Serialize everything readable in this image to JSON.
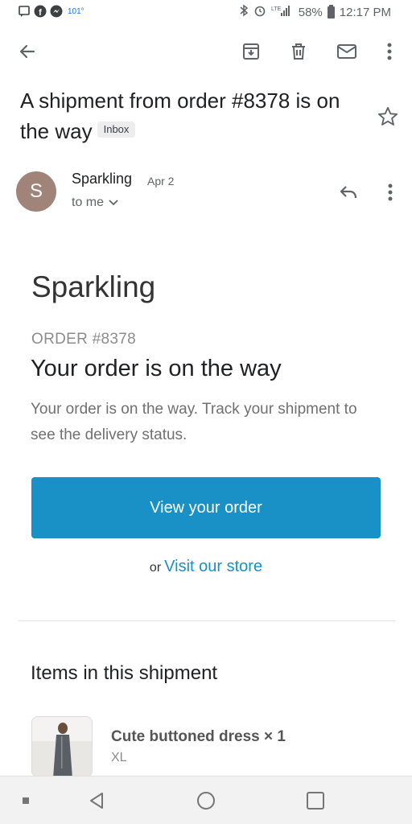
{
  "status_bar": {
    "temperature": "101°",
    "battery": "58%",
    "time": "12:17 PM",
    "icons": [
      "message-icon",
      "facebook-icon",
      "messenger-icon",
      "bluetooth-icon",
      "alarm-icon",
      "signal-icon",
      "battery-icon"
    ]
  },
  "toolbar": {
    "icons": [
      "back-arrow-icon",
      "archive-icon",
      "delete-icon",
      "mail-icon",
      "more-vert-icon"
    ]
  },
  "email": {
    "subject": "A shipment from order #8378 is on the way",
    "label": "Inbox",
    "sender_initial": "S",
    "sender_name": "Sparkling",
    "date": "Apr 2",
    "recipient": "to me"
  },
  "body": {
    "shop_name": "Sparkling",
    "order_number": "ORDER #8378",
    "heading": "Your order is on the way",
    "description": "Your order is on the way. Track your shipment to see the delivery status.",
    "button_label": "View your order",
    "store_prefix": "or",
    "store_link": "Visit our store",
    "items_heading": "Items in this shipment",
    "items": [
      {
        "name": "Cute buttoned dress × 1",
        "variant": "XL"
      }
    ]
  },
  "colors": {
    "accent": "#1990c6",
    "avatar": "#a18479"
  }
}
